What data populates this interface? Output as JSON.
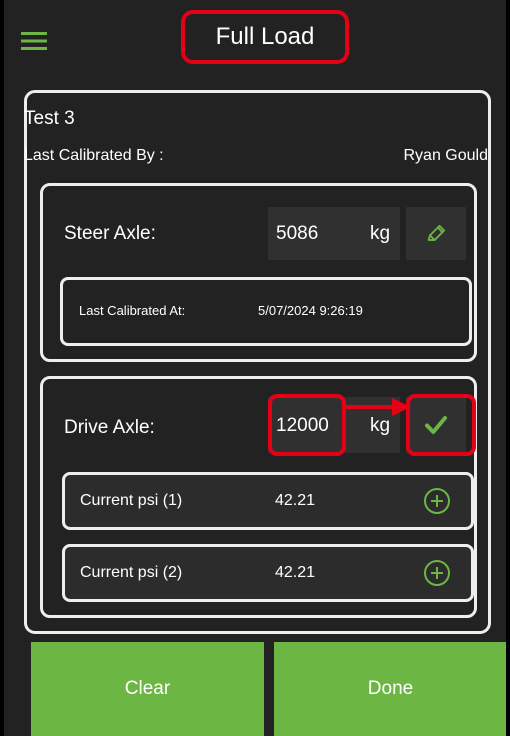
{
  "header": {
    "title": "Full Load",
    "menu_icon": "hamburger-menu-icon"
  },
  "test": {
    "name": "Test 3",
    "last_calibrated_by_label": "Last Calibrated By :",
    "last_calibrated_by_value": "Ryan Gould"
  },
  "steer_axle": {
    "label": "Steer Axle:",
    "value": "5086",
    "unit": "kg",
    "action_icon": "pencil-edit-icon",
    "last_calibrated_at_label": "Last Calibrated At:",
    "last_calibrated_at_value": "5/07/2024 9:26:19"
  },
  "drive_axle": {
    "label": "Drive Axle:",
    "value": "12000",
    "unit": "kg",
    "action_icon": "checkmark-icon",
    "pressures": [
      {
        "label": "Current psi (1)",
        "value": "42.21",
        "action_icon": "plus-circle-icon"
      },
      {
        "label": "Current psi (2)",
        "value": "42.21",
        "action_icon": "plus-circle-icon"
      }
    ]
  },
  "actions": {
    "clear_label": "Clear",
    "done_label": "Done"
  },
  "colors": {
    "background": "#222222",
    "field": "#303030",
    "accent_green": "#6cb644",
    "annotation_red": "#e40015",
    "border": "#eeeeee"
  }
}
